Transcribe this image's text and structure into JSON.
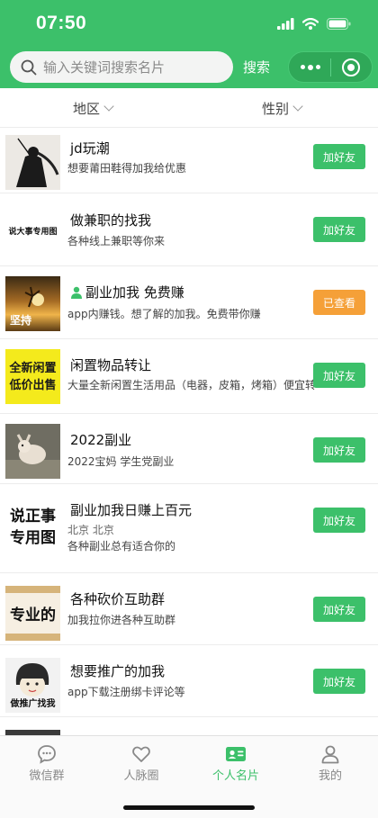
{
  "status": {
    "time": "07:50"
  },
  "search": {
    "placeholder": "输入关键词搜索名片",
    "button_label": "搜索"
  },
  "filters": {
    "region": "地区",
    "gender": "性别"
  },
  "items": [
    {
      "title": "jd玩潮",
      "desc": "想要莆田鞋得加我给优惠",
      "button": "加好友",
      "thumb_text": ""
    },
    {
      "title": "做兼职的找我",
      "desc": "各种线上兼职等你来",
      "button": "加好友",
      "thumb_text": "说大事专用图"
    },
    {
      "title": "副业加我 免费赚",
      "desc": "app内赚钱。想了解的加我。免费带你赚",
      "button": "已查看",
      "thumb_text": "坚持"
    },
    {
      "title": "闲置物品转让",
      "desc": "大量全新闲置生活用品（电器，皮箱，烤箱）便宜转",
      "button": "加好友",
      "thumb_text_1": "全新闲置",
      "thumb_text_2": "低价出售"
    },
    {
      "title": "2022副业",
      "desc": "2022宝妈 学生党副业",
      "button": "加好友",
      "thumb_text": ""
    },
    {
      "title": "副业加我日赚上百元",
      "location": "北京 北京",
      "desc": "各种副业总有适合你的",
      "button": "加好友",
      "thumb_text_1": "说正事",
      "thumb_text_2": "专用图"
    },
    {
      "title": "各种砍价互助群",
      "desc": "加我拉你进各种互助群",
      "button": "加好友",
      "thumb_text": "专业的"
    },
    {
      "title": "想要推广的加我",
      "desc": "app下载注册绑卡评论等",
      "button": "加好友",
      "thumb_text": "做推广找我"
    }
  ],
  "tabs": [
    {
      "label": "微信群",
      "icon": "chat-bubble-icon"
    },
    {
      "label": "人脉圈",
      "icon": "heart-icon"
    },
    {
      "label": "个人名片",
      "icon": "id-card-icon",
      "active": true
    },
    {
      "label": "我的",
      "icon": "user-icon"
    }
  ],
  "colors": {
    "primary": "#3cc06a",
    "viewed": "#f5a038"
  }
}
